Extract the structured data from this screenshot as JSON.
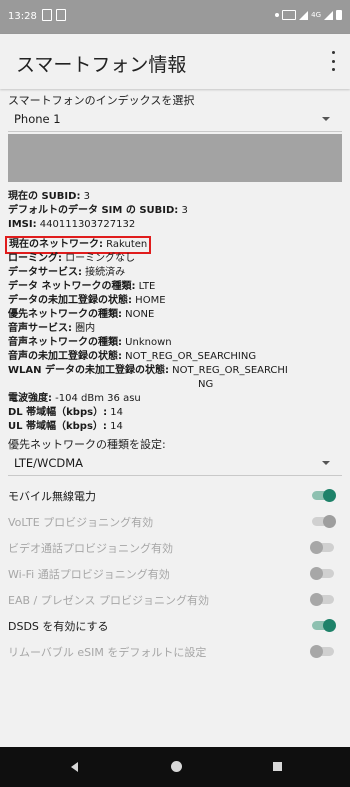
{
  "status": {
    "time": "13:28"
  },
  "appbar": {
    "title": "スマートフォン情報",
    "menu_icon": "more-vert-icon"
  },
  "phone_select": {
    "label": "スマートフォンのインデックスを選択",
    "value": "Phone 1"
  },
  "info": [
    {
      "key": "現在の SUBID:",
      "value": " 3"
    },
    {
      "key": "デフォルトのデータ SIM の SUBID:",
      "value": " 3"
    },
    {
      "key": "IMSI:",
      "value": " 440111303727132"
    },
    {
      "key": "現在のネットワーク:",
      "value": " Rakuten",
      "highlight": true
    },
    {
      "key": "ローミング:",
      "value": " ローミングなし"
    },
    {
      "key": "データサービス:",
      "value": " 接続済み"
    },
    {
      "key": "データ ネットワークの種類:",
      "value": " LTE"
    },
    {
      "key": "データの未加工登録の状態:",
      "value": " HOME"
    },
    {
      "key": "優先ネットワークの種類:",
      "value": " NONE"
    },
    {
      "key": "音声サービス:",
      "value": " 圏内"
    },
    {
      "key": "音声ネットワークの種類:",
      "value": " Unknown"
    },
    {
      "key": "音声の未加工登録の状態:",
      "value": " NOT_REG_OR_SEARCHING"
    },
    {
      "key": "WLAN データの未加工登録の状態:",
      "value": " NOT_REG_OR_SEARCHI",
      "value2": "NG"
    },
    {
      "key": "電波強度:",
      "value": " -104 dBm   36 asu"
    },
    {
      "key": "DL 帯域幅（kbps）:",
      "value": " 14"
    },
    {
      "key": "UL 帯域幅（kbps）:",
      "value": " 14"
    }
  ],
  "network_select": {
    "label": "優先ネットワークの種類を設定:",
    "value": "LTE/WCDMA"
  },
  "toggles": [
    {
      "label": "モバイル無線電力",
      "state": "on",
      "enabled": true
    },
    {
      "label": "VoLTE プロビジョニング有効",
      "state": "on",
      "enabled": false
    },
    {
      "label": "ビデオ通話プロビジョニング有効",
      "state": "off",
      "enabled": false
    },
    {
      "label": "Wi-Fi 通話プロビジョニング有効",
      "state": "off",
      "enabled": false
    },
    {
      "label": "EAB / プレゼンス プロビジョニング有効",
      "state": "off",
      "enabled": false
    },
    {
      "label": "DSDS を有効にする",
      "state": "on",
      "enabled": true
    },
    {
      "label": "リムーバブル eSIM をデフォルトに設定",
      "state": "off",
      "enabled": false
    }
  ],
  "colors": {
    "accent": "#1e8269",
    "highlight": "#e01c1c"
  }
}
